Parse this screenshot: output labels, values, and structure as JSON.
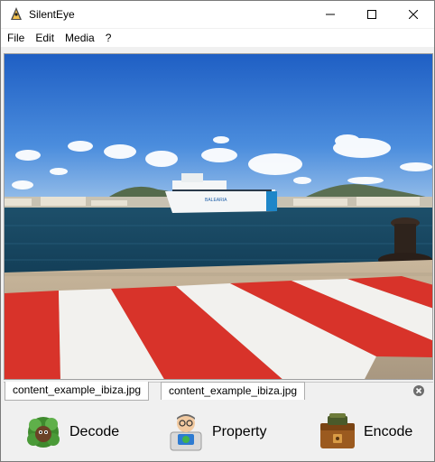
{
  "window": {
    "title": "SilentEye"
  },
  "menu": {
    "items": [
      "File",
      "Edit",
      "Media",
      "?"
    ]
  },
  "tabs": [
    {
      "label": "content_example_ibiza.jpg"
    },
    {
      "label": "content_example_ibiza.jpg"
    }
  ],
  "ship_name": "BALEARIA",
  "actions": {
    "decode": "Decode",
    "property": "Property",
    "encode": "Encode"
  }
}
